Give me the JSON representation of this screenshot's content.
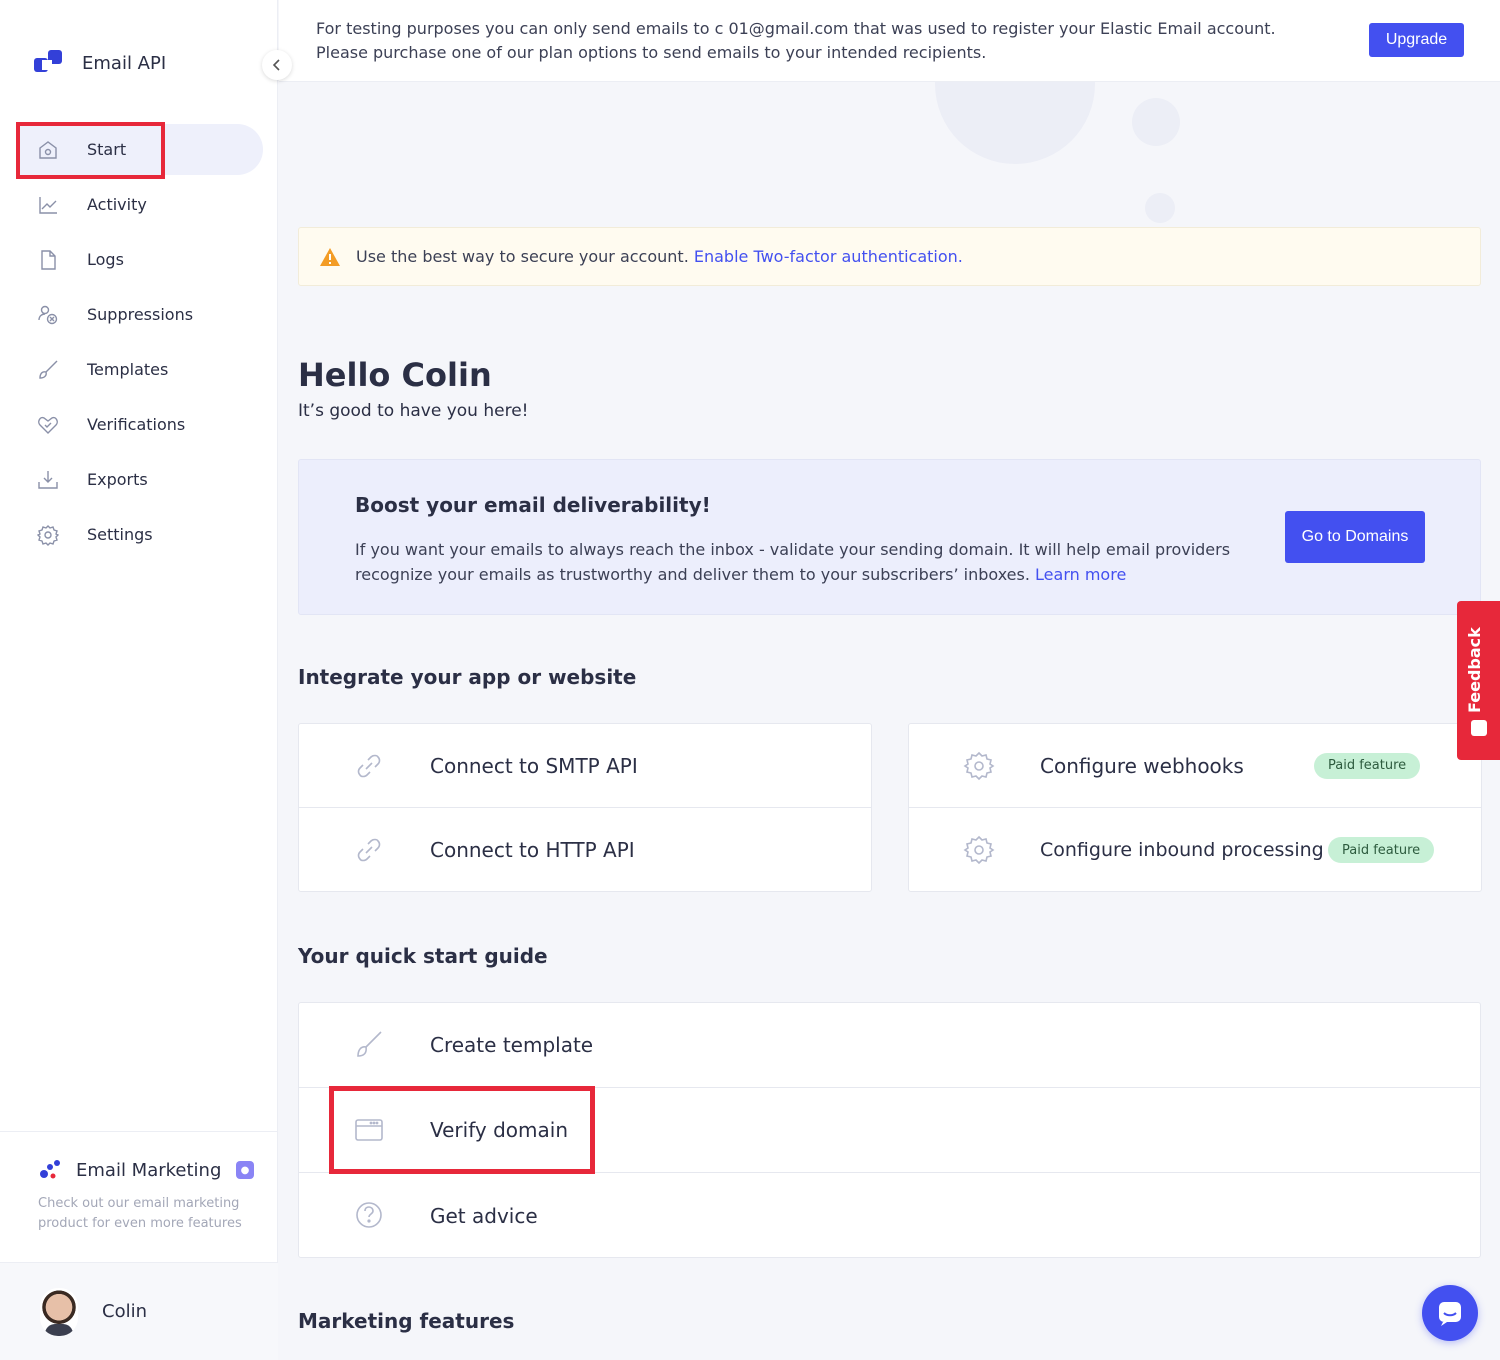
{
  "app": {
    "title": "Email API"
  },
  "sidebar": {
    "items": [
      {
        "label": "Start",
        "icon": "home-icon"
      },
      {
        "label": "Activity",
        "icon": "chart-icon"
      },
      {
        "label": "Logs",
        "icon": "file-icon"
      },
      {
        "label": "Suppressions",
        "icon": "suppression-icon"
      },
      {
        "label": "Templates",
        "icon": "brush-icon"
      },
      {
        "label": "Verifications",
        "icon": "heart-check-icon"
      },
      {
        "label": "Exports",
        "icon": "download-icon"
      },
      {
        "label": "Settings",
        "icon": "gear-icon"
      }
    ],
    "marketing": {
      "title": "Email Marketing",
      "description": "Check out our email marketing product for even more features"
    },
    "user": {
      "name": "Colin"
    }
  },
  "banner": {
    "text": "For testing purposes you can only send emails to c  01@gmail.com that was used to register your Elastic Email account. Please purchase one of our plan options to send emails to your intended recipients.",
    "button": "Upgrade"
  },
  "alert": {
    "text": "Use the best way to secure your account. ",
    "link": "Enable Two-factor authentication."
  },
  "greeting": {
    "title": "Hello Colin",
    "subtitle": "It’s good to have you here!"
  },
  "boost": {
    "title": "Boost your email deliverability!",
    "text": "If you want your emails to always reach the inbox - validate your sending domain. It will help email providers recognize your emails as trustworthy and deliver them to your subscribers’ inboxes. ",
    "link": "Learn more",
    "button": "Go to Domains"
  },
  "integrate": {
    "title": "Integrate your app or website",
    "left": [
      {
        "label": "Connect to SMTP API",
        "icon": "link-icon"
      },
      {
        "label": "Connect to HTTP API",
        "icon": "link-icon"
      }
    ],
    "right": [
      {
        "label": "Configure webhooks",
        "icon": "gear-icon",
        "badge": "Paid feature"
      },
      {
        "label": "Configure inbound processing",
        "icon": "gear-icon",
        "badge": "Paid feature"
      }
    ]
  },
  "quickstart": {
    "title": "Your quick start guide",
    "items": [
      {
        "label": "Create template",
        "icon": "brush-icon"
      },
      {
        "label": "Verify domain",
        "icon": "browser-icon"
      },
      {
        "label": "Get advice",
        "icon": "question-icon"
      }
    ]
  },
  "marketing_features": {
    "title": "Marketing features"
  },
  "feedback": {
    "label": "Feedback"
  },
  "colors": {
    "accent": "#4350f0",
    "highlight": "#e7283a",
    "paid_bg": "#c7f0d6"
  }
}
